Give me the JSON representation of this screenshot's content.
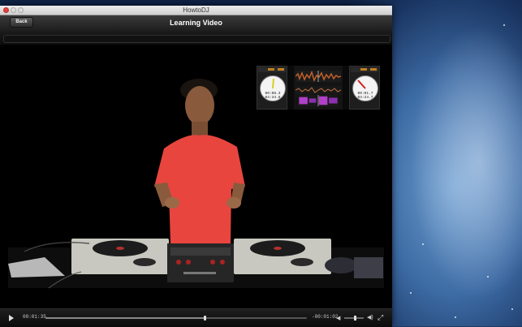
{
  "window": {
    "title": "HowtoDJ"
  },
  "toolbar": {
    "back_label": "Back",
    "page_title": "Learning Video"
  },
  "overlay": {
    "left_deck": {
      "time_elapsed": "00:08.3",
      "time_remaining": "04:34.6"
    },
    "right_deck": {
      "time_elapsed": "00:01.7",
      "time_remaining": "04:24.7"
    }
  },
  "player": {
    "elapsed": "00:01:35",
    "remaining": "-00:01:02",
    "progress_fraction": 0.61,
    "volume_fraction": 0.55
  },
  "colors": {
    "accent_wave_top": "#c0602a",
    "accent_wave_bottom": "#b040c8",
    "shirt": "#e8453f"
  }
}
